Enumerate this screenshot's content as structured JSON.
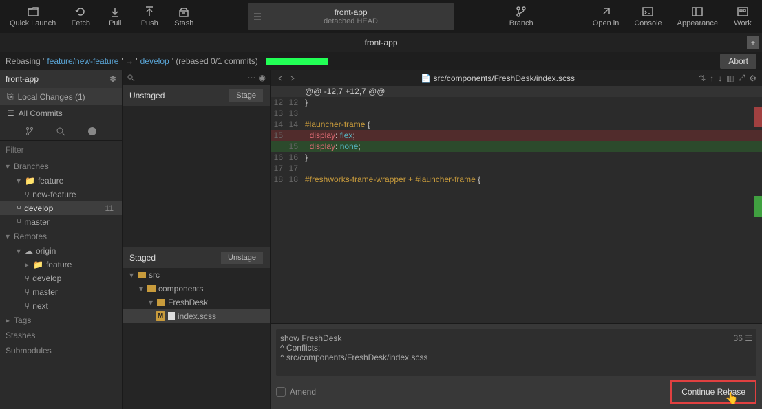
{
  "toolbar": {
    "quick_launch": "Quick Launch",
    "fetch": "Fetch",
    "pull": "Pull",
    "push": "Push",
    "stash": "Stash",
    "repo_name": "front-app",
    "repo_state": "detached HEAD",
    "branch": "Branch",
    "open_in": "Open in",
    "console": "Console",
    "appearance": "Appearance",
    "work": "Work"
  },
  "tab": {
    "name": "front-app"
  },
  "rebase": {
    "prefix": "Rebasing '",
    "from": "feature/new-feature",
    "arrow": "' → '",
    "to": "develop",
    "suffix": "' (rebased 0/1 commits)",
    "abort": "Abort"
  },
  "sidebar": {
    "title": "front-app",
    "local_changes": "Local Changes (1)",
    "all_commits": "All Commits",
    "filter_placeholder": "Filter",
    "branches": "Branches",
    "feature": "feature",
    "new_feature": "new-feature",
    "develop": "develop",
    "develop_count": "11",
    "master": "master",
    "remotes": "Remotes",
    "origin": "origin",
    "r_feature": "feature",
    "r_develop": "develop",
    "r_master": "master",
    "r_next": "next",
    "tags": "Tags",
    "stashes": "Stashes",
    "submodules": "Submodules"
  },
  "panels": {
    "unstaged": "Unstaged",
    "stage_btn": "Stage",
    "staged": "Staged",
    "unstage_btn": "Unstage",
    "tree": {
      "src": "src",
      "components": "components",
      "freshdesk": "FreshDesk",
      "indexscss": "index.scss"
    }
  },
  "diff": {
    "path": "src/components/FreshDesk/index.scss",
    "hunk": "@@ -12,7 +12,7 @@",
    "lines": [
      {
        "l1": "12",
        "l2": "12",
        "t": "}"
      },
      {
        "l1": "13",
        "l2": "13",
        "t": ""
      },
      {
        "l1": "14",
        "l2": "14",
        "t": "#launcher-frame {"
      },
      {
        "l1": "15",
        "l2": "",
        "t": "  display: flex;",
        "cls": "del"
      },
      {
        "l1": "",
        "l2": "15",
        "t": "  display: none;",
        "cls": "add"
      },
      {
        "l1": "16",
        "l2": "16",
        "t": "}"
      },
      {
        "l1": "17",
        "l2": "17",
        "t": ""
      },
      {
        "l1": "18",
        "l2": "18",
        "t": "#freshworks-frame-wrapper + #launcher-frame {"
      }
    ]
  },
  "commit": {
    "title": "show FreshDesk",
    "count": "36",
    "conflicts_label": "^  Conflicts:",
    "conflict_file": "^      src/components/FreshDesk/index.scss",
    "amend": "Amend",
    "continue": "Continue Rebase"
  }
}
